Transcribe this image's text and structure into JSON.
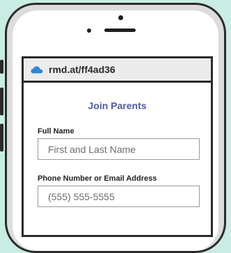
{
  "browser": {
    "url": "rmd.at/ff4ad36",
    "favicon_icon": "cloud-icon",
    "accent_color": "#2f86d8"
  },
  "form": {
    "title": "Join Parents",
    "title_color": "#4f5aa8",
    "full_name": {
      "label": "Full Name",
      "placeholder": "First and Last Name"
    },
    "contact": {
      "label": "Phone Number or Email Address",
      "placeholder": "(555) 555-5555"
    }
  },
  "background_color": "#c9ece3"
}
